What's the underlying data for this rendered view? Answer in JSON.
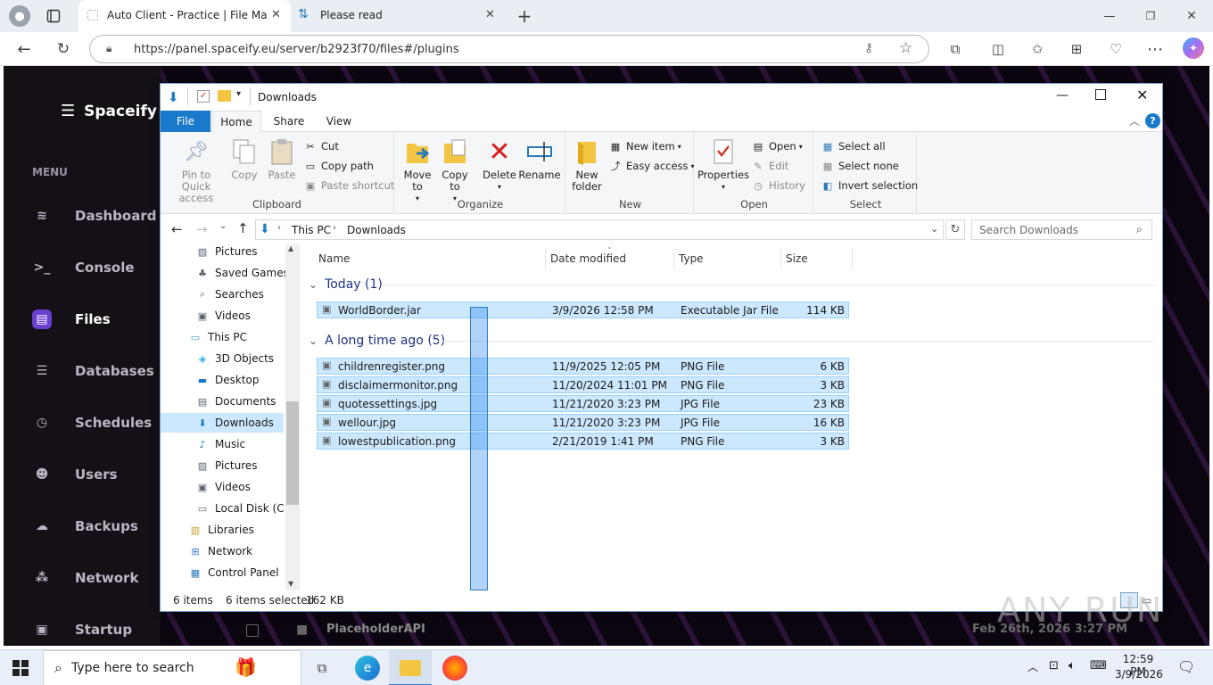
{
  "browser": {
    "tabs": [
      {
        "title": "Auto Client - Practice | File Manag"
      },
      {
        "title": "Please read"
      }
    ],
    "url": "https://panel.spaceify.eu/server/b2923f70/files#/plugins"
  },
  "panel": {
    "brand": "Spaceify",
    "menu_label": "MENU",
    "nav": [
      {
        "label": "Dashboard",
        "icon": "layers-icon"
      },
      {
        "label": "Console",
        "icon": "terminal-icon"
      },
      {
        "label": "Files",
        "icon": "file-icon"
      },
      {
        "label": "Databases",
        "icon": "database-icon"
      },
      {
        "label": "Schedules",
        "icon": "clock-icon"
      },
      {
        "label": "Users",
        "icon": "users-icon"
      },
      {
        "label": "Backups",
        "icon": "cloud-icon"
      },
      {
        "label": "Network",
        "icon": "network-icon"
      },
      {
        "label": "Startup",
        "icon": "startup-icon"
      }
    ],
    "background_file": "PlaceholderAPI",
    "background_date": "Feb 26th, 2026 3:27 PM"
  },
  "explorer": {
    "title": "Downloads",
    "ribbon_tabs": [
      "File",
      "Home",
      "Share",
      "View"
    ],
    "clipboard": {
      "group": "Clipboard",
      "pin": "Pin to Quick access",
      "copy": "Copy",
      "paste": "Paste",
      "cut": "Cut",
      "copy_path": "Copy path",
      "paste_shortcut": "Paste shortcut"
    },
    "organize": {
      "group": "Organize",
      "move_to": "Move to",
      "copy_to": "Copy to",
      "delete": "Delete",
      "rename": "Rename"
    },
    "new": {
      "group": "New",
      "new_folder": "New folder",
      "new_item": "New item",
      "easy_access": "Easy access"
    },
    "open": {
      "group": "Open",
      "properties": "Properties",
      "open": "Open",
      "edit": "Edit",
      "history": "History"
    },
    "select": {
      "group": "Select",
      "select_all": "Select all",
      "select_none": "Select none",
      "invert": "Invert selection"
    },
    "breadcrumb": [
      "This PC",
      "Downloads"
    ],
    "search_placeholder": "Search Downloads",
    "tree": [
      {
        "label": "Pictures",
        "icon": "pictures-icon",
        "indent": 1
      },
      {
        "label": "Saved Games",
        "icon": "saved-games-icon",
        "indent": 1
      },
      {
        "label": "Searches",
        "icon": "search-icon",
        "indent": 1
      },
      {
        "label": "Videos",
        "icon": "videos-icon",
        "indent": 1
      },
      {
        "label": "This PC",
        "icon": "computer-icon",
        "indent": 0
      },
      {
        "label": "3D Objects",
        "icon": "cube-icon",
        "indent": 1
      },
      {
        "label": "Desktop",
        "icon": "desktop-icon",
        "indent": 1
      },
      {
        "label": "Documents",
        "icon": "documents-icon",
        "indent": 1
      },
      {
        "label": "Downloads",
        "icon": "downloads-icon",
        "indent": 1,
        "selected": true
      },
      {
        "label": "Music",
        "icon": "music-icon",
        "indent": 1
      },
      {
        "label": "Pictures",
        "icon": "pictures-icon",
        "indent": 1
      },
      {
        "label": "Videos",
        "icon": "videos-icon",
        "indent": 1
      },
      {
        "label": "Local Disk (C:)",
        "icon": "drive-icon",
        "indent": 1
      },
      {
        "label": "Libraries",
        "icon": "libraries-icon",
        "indent": 0
      },
      {
        "label": "Network",
        "icon": "network-icon",
        "indent": 0
      },
      {
        "label": "Control Panel",
        "icon": "control-panel-icon",
        "indent": 0
      }
    ],
    "columns": {
      "name": "Name",
      "date": "Date modified",
      "type": "Type",
      "size": "Size"
    },
    "groups": [
      {
        "header": "Today (1)",
        "files": [
          {
            "name": "WorldBorder.jar",
            "date": "3/9/2026 12:58 PM",
            "type": "Executable Jar File",
            "size": "114 KB"
          }
        ]
      },
      {
        "header": "A long time ago (5)",
        "files": [
          {
            "name": "childrenregister.png",
            "date": "11/9/2025 12:05 PM",
            "type": "PNG File",
            "size": "6 KB"
          },
          {
            "name": "disclaimermonitor.png",
            "date": "11/20/2024 11:01 PM",
            "type": "PNG File",
            "size": "3 KB"
          },
          {
            "name": "quotessettings.jpg",
            "date": "11/21/2020 3:23 PM",
            "type": "JPG File",
            "size": "23 KB"
          },
          {
            "name": "wellour.jpg",
            "date": "11/21/2020 3:23 PM",
            "type": "JPG File",
            "size": "16 KB"
          },
          {
            "name": "lowestpublication.png",
            "date": "2/21/2019 1:41 PM",
            "type": "PNG File",
            "size": "3 KB"
          }
        ]
      }
    ],
    "status": {
      "count": "6 items",
      "selected": "6 items selected",
      "size": "162 KB"
    }
  },
  "taskbar": {
    "search_placeholder": "Type here to search",
    "time": "12:59 PM",
    "date": "3/9/2026"
  },
  "watermark": "ANY RUN",
  "colors": {
    "accent": "#6a3fd0",
    "selection": "#cce8ff",
    "selection_border": "#99d1ff",
    "file_tab": "#1979ca"
  }
}
